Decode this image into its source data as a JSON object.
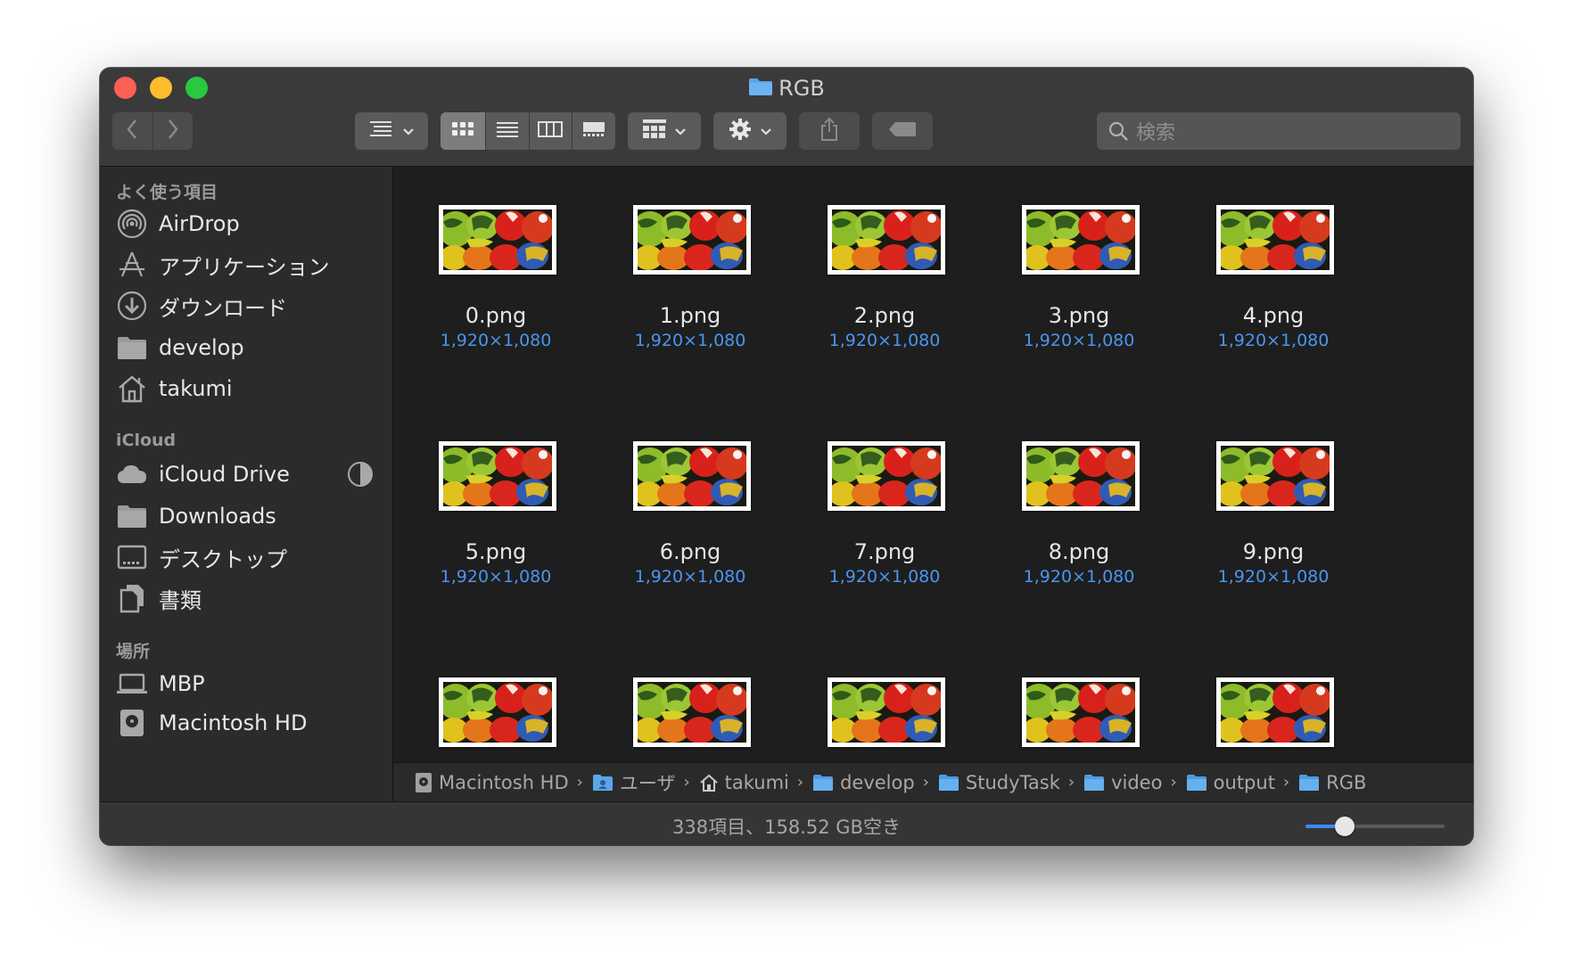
{
  "window": {
    "title": "RGB"
  },
  "toolbar": {
    "back_icon": "chevron-left-icon",
    "forward_icon": "chevron-right-icon",
    "sort_icon": "sort-list-icon",
    "view_modes": [
      "icon-view",
      "list-view",
      "column-view",
      "gallery-view"
    ],
    "active_view": "icon-view",
    "group_icon": "group-grid-icon",
    "action_icon": "gear-icon",
    "share_icon": "share-icon",
    "tag_icon": "tag-icon"
  },
  "search": {
    "placeholder": "検索"
  },
  "sidebar": {
    "favorites_header": "よく使う項目",
    "favorites": [
      {
        "label": "AirDrop",
        "icon": "airdrop-icon"
      },
      {
        "label": "アプリケーション",
        "icon": "applications-icon"
      },
      {
        "label": "ダウンロード",
        "icon": "download-icon"
      },
      {
        "label": "develop",
        "icon": "folder-icon"
      },
      {
        "label": "takumi",
        "icon": "home-icon"
      }
    ],
    "icloud_header": "iCloud",
    "icloud": [
      {
        "label": "iCloud Drive",
        "icon": "cloud-icon"
      },
      {
        "label": "Downloads",
        "icon": "folder-icon"
      },
      {
        "label": "デスクトップ",
        "icon": "desktop-icon"
      },
      {
        "label": "書類",
        "icon": "document-icon"
      }
    ],
    "locations_header": "場所",
    "locations": [
      {
        "label": "MBP",
        "icon": "laptop-icon"
      },
      {
        "label": "Macintosh HD",
        "icon": "disk-icon"
      }
    ]
  },
  "files": [
    {
      "name": "0.png",
      "dims": "1,920×1,080"
    },
    {
      "name": "1.png",
      "dims": "1,920×1,080"
    },
    {
      "name": "2.png",
      "dims": "1,920×1,080"
    },
    {
      "name": "3.png",
      "dims": "1,920×1,080"
    },
    {
      "name": "4.png",
      "dims": "1,920×1,080"
    },
    {
      "name": "5.png",
      "dims": "1,920×1,080"
    },
    {
      "name": "6.png",
      "dims": "1,920×1,080"
    },
    {
      "name": "7.png",
      "dims": "1,920×1,080"
    },
    {
      "name": "8.png",
      "dims": "1,920×1,080"
    },
    {
      "name": "9.png",
      "dims": "1,920×1,080"
    },
    {
      "name": "",
      "dims": ""
    },
    {
      "name": "",
      "dims": ""
    },
    {
      "name": "",
      "dims": ""
    },
    {
      "name": "",
      "dims": ""
    },
    {
      "name": "",
      "dims": ""
    }
  ],
  "path": [
    {
      "label": "Macintosh HD",
      "icon": "disk-icon"
    },
    {
      "label": "ユーザ",
      "icon": "users-folder-icon"
    },
    {
      "label": "takumi",
      "icon": "home-icon"
    },
    {
      "label": "develop",
      "icon": "folder-icon"
    },
    {
      "label": "StudyTask",
      "icon": "folder-icon"
    },
    {
      "label": "video",
      "icon": "folder-icon"
    },
    {
      "label": "output",
      "icon": "folder-icon"
    },
    {
      "label": "RGB",
      "icon": "folder-icon"
    }
  ],
  "status": {
    "text": "338項目、158.52 GB空き",
    "icon_size_level": 0.28
  },
  "colors": {
    "accent": "#3b8bf5",
    "dims_text": "#4a95f0",
    "folder": "#5aa6e8"
  }
}
